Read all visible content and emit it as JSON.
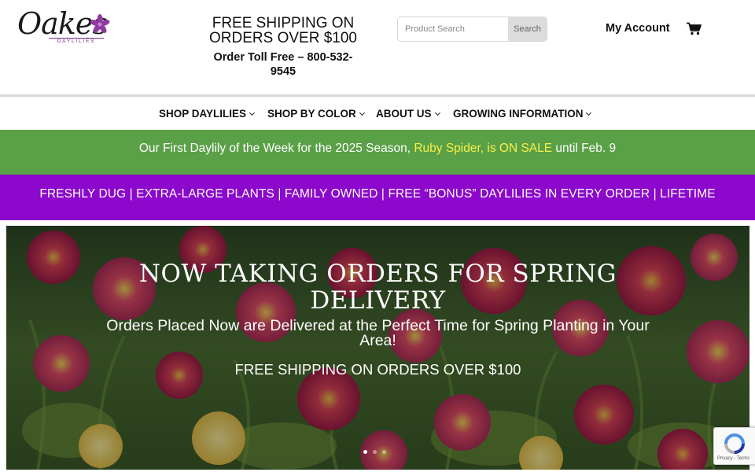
{
  "header": {
    "logo_text": "Oakes",
    "logo_sub": "DAYLILIES",
    "shipping_headline": "FREE SHIPPING ON ORDERS OVER $100",
    "toll_free": "Order Toll Free – 800-532-9545",
    "search": {
      "placeholder": "Product Search",
      "button_label": "Search"
    },
    "account_label": "My Account",
    "cart_icon": "cart-icon"
  },
  "nav": {
    "items": [
      {
        "label": "SHOP DAYLILIES"
      },
      {
        "label": "SHOP BY COLOR"
      },
      {
        "label": "ABOUT US"
      },
      {
        "label": "GROWING INFORMATION"
      }
    ]
  },
  "promo": {
    "text_before": "Our First Daylily of the Week for the 2025 Season, ",
    "highlight": "Ruby Spider, is ON SALE",
    "text_after": " until Feb. 9",
    "highlight_color": "#f7ef4a"
  },
  "features_bar": {
    "text": "FRESHLY DUG | EXTRA-LARGE PLANTS | FAMILY OWNED | FREE “BONUS” DAYLILIES IN EVERY ORDER | LIFETIME GUARANTEE"
  },
  "hero": {
    "title": "NOW TAKING ORDERS FOR SPRING DELIVERY",
    "subtitle": "Orders Placed Now are Delivered at the Perfect Time for Spring Planting in Your Area!",
    "shipping": "FREE SHIPPING ON ORDERS OVER $100",
    "slide_count": 3,
    "active_slide": 1
  },
  "recaptcha": {
    "links": "Privacy - Terms"
  },
  "colors": {
    "green_band": "#5aa047",
    "purple_band": "#8b08cc",
    "brand_purple": "#7a2a8a"
  }
}
